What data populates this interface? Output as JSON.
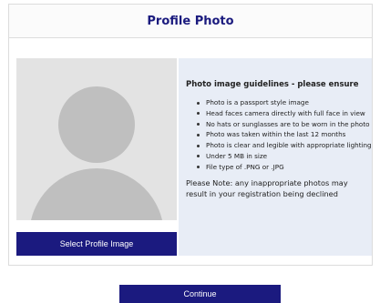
{
  "header": {
    "title": "Profile Photo"
  },
  "photo": {
    "placeholder_icon": "avatar-placeholder-icon",
    "select_label": "Select Profile Image"
  },
  "guidelines": {
    "title": "Photo image guidelines - please ensure",
    "items": [
      "Photo is a passport style image",
      "Head faces camera directly with full face in view",
      "No hats or sunglasses are to be worn in the photo",
      "Photo was taken within the last 12 months",
      "Photo is clear and legible with appropriate lighting",
      "Under 5 MB in size",
      "File type of .PNG or .JPG"
    ],
    "note": "Please Note: any inappropriate photos may result in your registration being declined"
  },
  "footer": {
    "continue_label": "Continue"
  },
  "colors": {
    "brand_navy": "#1b1a7f",
    "title_navy": "#1a1a7e",
    "guidelines_bg": "#e8edf6",
    "placeholder_bg": "#e3e3e3",
    "placeholder_fg": "#bfbfbf"
  }
}
